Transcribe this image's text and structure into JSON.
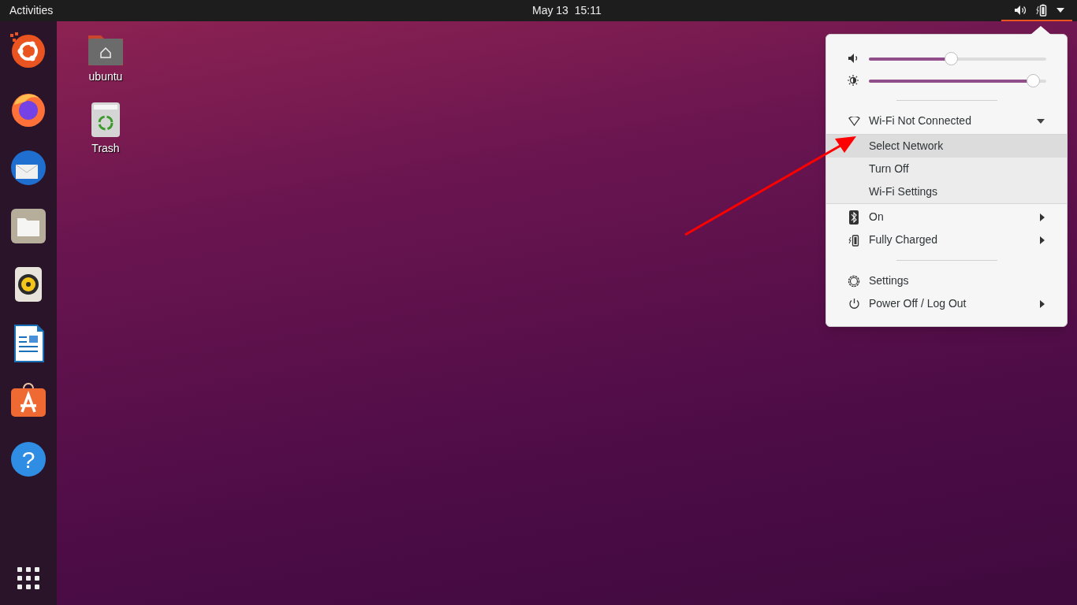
{
  "top_bar": {
    "activities": "Activities",
    "clock": "May 13  15:11"
  },
  "dock": {
    "apps": [
      {
        "kind": "ubuntu"
      },
      {
        "kind": "firefox"
      },
      {
        "kind": "thunderbird"
      },
      {
        "kind": "files"
      },
      {
        "kind": "rhythmbox"
      },
      {
        "kind": "writer"
      },
      {
        "kind": "software"
      },
      {
        "kind": "help",
        "glyph": "?"
      }
    ]
  },
  "desktop_icons": [
    {
      "kind": "home-folder",
      "label": "ubuntu"
    },
    {
      "kind": "trash",
      "label": "Trash"
    }
  ],
  "system_menu": {
    "sliders": [
      {
        "kind": "volume",
        "level": 0.46
      },
      {
        "kind": "brightness",
        "level": 0.96
      }
    ],
    "wifi": {
      "label": "Wi-Fi Not Connected",
      "expanded": true,
      "items": [
        {
          "label": "Select Network",
          "selected": true
        },
        {
          "label": "Turn Off",
          "selected": false
        },
        {
          "label": "Wi-Fi Settings",
          "selected": false
        }
      ]
    },
    "rows": [
      {
        "kind": "bluetooth",
        "label": "On",
        "submenu": true
      },
      {
        "kind": "battery",
        "label": "Fully Charged",
        "submenu": true
      },
      {
        "kind": "separator"
      },
      {
        "kind": "settings",
        "label": "Settings",
        "submenu": false
      },
      {
        "kind": "power",
        "label": "Power Off / Log Out",
        "submenu": true
      }
    ]
  }
}
